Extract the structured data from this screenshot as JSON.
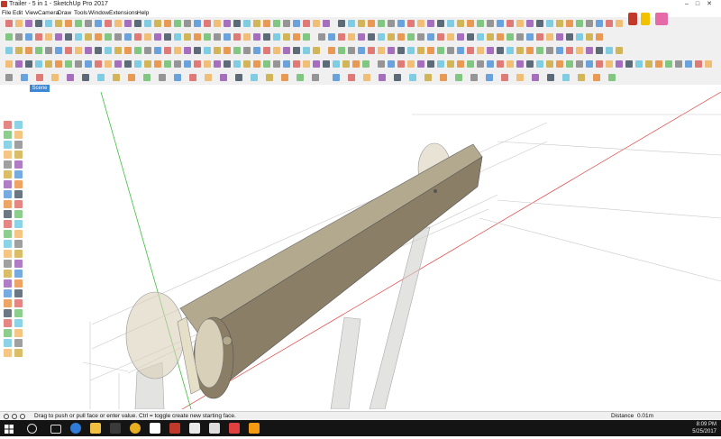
{
  "window": {
    "title": "Trailer - 5 in 1 - SketchUp Pro 2017",
    "buttons": [
      "minimize-icon",
      "maximize-icon",
      "close-icon"
    ]
  },
  "menu": [
    "File",
    "Edit",
    "View",
    "Camera",
    "Draw",
    "Tools",
    "Window",
    "Extensions",
    "Help"
  ],
  "scene_tab": "Scene 1",
  "toolbar_icons": "icon toolbar rows (draw, edit, camera, styles, extension tools)",
  "status": {
    "hint": "Drag to push or pull face or enter value.  Ctrl = toggle create new starting face.",
    "measure_label": "Distance",
    "measure_value": "0.01m"
  },
  "taskbar": {
    "search_placeholder": "",
    "time": "8:09 PM",
    "date": "5/25/2017",
    "apps": [
      "start-icon",
      "search-icon",
      "task-view-icon",
      "edge-icon",
      "explorer-icon",
      "chrome-icon",
      "store-icon",
      "gmail-icon",
      "sketchup-icon",
      "app-icon",
      "app-icon",
      "app-icon",
      "app-icon"
    ]
  },
  "colors": {
    "red_axis": "#e04040",
    "green_axis": "#3cbe3c",
    "board": "#8b7e66",
    "board_light": "#b3a98e",
    "wheel": "#d8d0b8",
    "selection_blue": "#3c88d6"
  }
}
